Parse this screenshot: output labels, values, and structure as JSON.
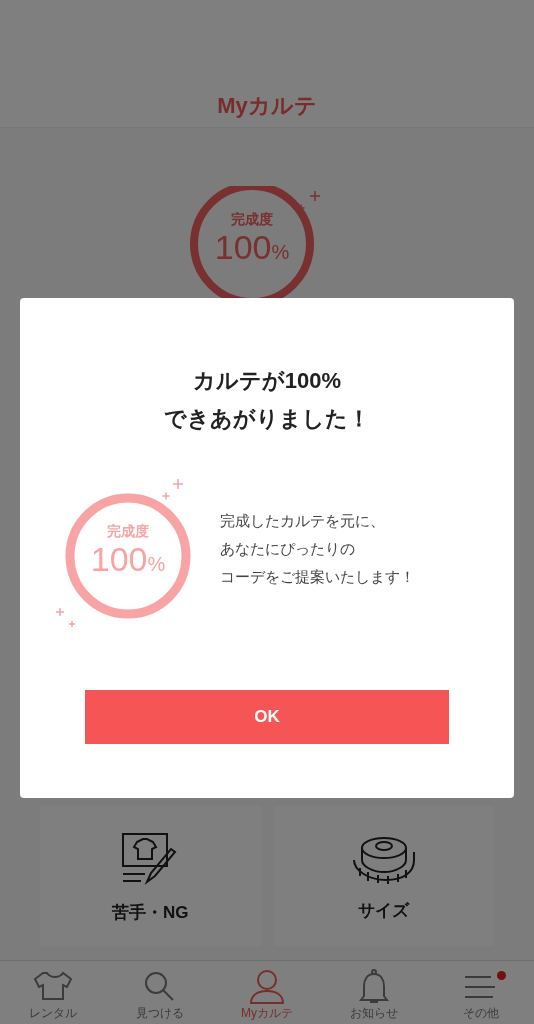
{
  "header": {
    "title": "Myカルテ"
  },
  "completion_badge": {
    "label": "完成度",
    "value": "100",
    "unit": "%"
  },
  "cards": [
    {
      "kind": "ng",
      "label": "苦手・NG"
    },
    {
      "kind": "size",
      "label": "サイズ"
    }
  ],
  "bottom_nav": [
    {
      "kind": "shirt",
      "label": "レンタル",
      "selected": false,
      "dot": false
    },
    {
      "kind": "search",
      "label": "見つける",
      "selected": false,
      "dot": false
    },
    {
      "kind": "person",
      "label": "Myカルテ",
      "selected": true,
      "dot": false
    },
    {
      "kind": "bell",
      "label": "お知らせ",
      "selected": false,
      "dot": false
    },
    {
      "kind": "menu",
      "label": "その他",
      "selected": false,
      "dot": true
    }
  ],
  "dialog": {
    "title_lines": [
      "カルテが100%",
      "できあがりました！"
    ],
    "badge": {
      "label": "完成度",
      "value": "100",
      "unit": "%"
    },
    "message_lines": [
      "完成したカルテを元に、",
      "あなたにぴったりの",
      "コーデをご提案いたします！"
    ],
    "button": "OK"
  }
}
